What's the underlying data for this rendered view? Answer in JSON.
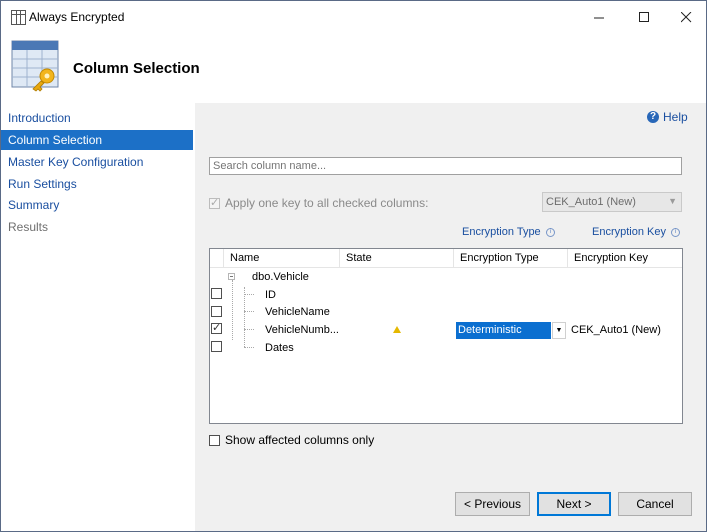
{
  "window": {
    "title": "Always Encrypted"
  },
  "header": {
    "title": "Column Selection"
  },
  "nav": {
    "items": [
      {
        "label": "Introduction"
      },
      {
        "label": "Column Selection"
      },
      {
        "label": "Master Key Configuration"
      },
      {
        "label": "Run Settings"
      },
      {
        "label": "Summary"
      },
      {
        "label": "Results"
      }
    ]
  },
  "help": {
    "label": "Help"
  },
  "search": {
    "placeholder": "Search column name..."
  },
  "apply_key": {
    "label": "Apply one key to all checked columns:",
    "checked": true,
    "key_value": "CEK_Auto1 (New)"
  },
  "hints": {
    "encryption_type": "Encryption Type",
    "encryption_key": "Encryption Key"
  },
  "grid": {
    "columns": [
      "Name",
      "State",
      "Encryption Type",
      "Encryption Key"
    ],
    "table_name": "dbo.Vehicle",
    "rows": [
      {
        "name": "ID",
        "checked": false,
        "state": "",
        "encryption_type": "",
        "encryption_key": ""
      },
      {
        "name": "VehicleName",
        "checked": false,
        "state": "",
        "encryption_type": "",
        "encryption_key": ""
      },
      {
        "name": "VehicleNumb...",
        "checked": true,
        "state": "warning",
        "encryption_type": "Deterministic",
        "encryption_key": "CEK_Auto1 (New)"
      },
      {
        "name": "Dates",
        "checked": false,
        "state": "",
        "encryption_type": "",
        "encryption_key": ""
      }
    ]
  },
  "show_affected": {
    "label": "Show affected columns only",
    "checked": false
  },
  "buttons": {
    "previous": "< Previous",
    "next": "Next >",
    "cancel": "Cancel"
  },
  "colors": {
    "nav_active": "#1c70c7",
    "link": "#1a4fa0",
    "selection": "#0b6fd0"
  },
  "icons": {
    "window": "table-icon",
    "header": "table-key-icon",
    "warning": "warning-icon",
    "help": "help-icon"
  }
}
